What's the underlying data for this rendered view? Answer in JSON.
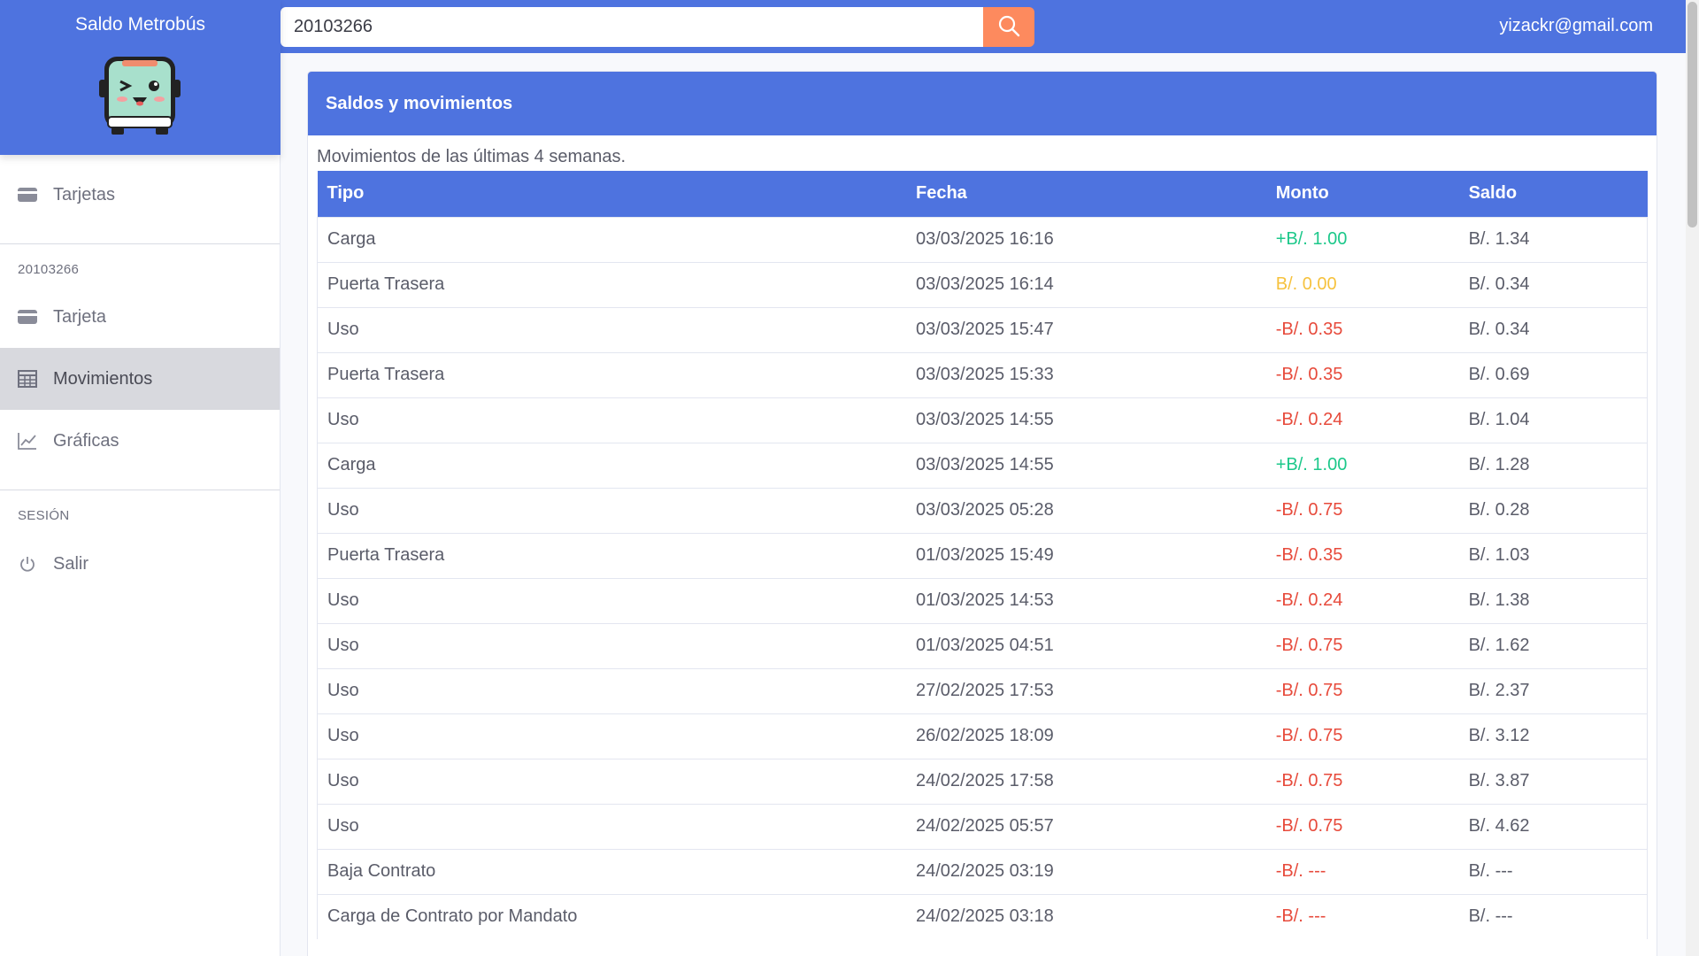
{
  "brand": {
    "title": "Saldo Metrobús",
    "logo_icon": "bus-mascot-icon"
  },
  "search": {
    "value": "20103266",
    "placeholder": "",
    "icon": "search-icon"
  },
  "user": {
    "email": "yizackr@gmail.com"
  },
  "sidebar": {
    "top_item": {
      "label": "Tarjetas",
      "icon": "card-icon"
    },
    "card_heading": "20103266",
    "card_items": [
      {
        "label": "Tarjeta",
        "icon": "card-icon"
      },
      {
        "label": "Movimientos",
        "icon": "table-icon",
        "active": true
      },
      {
        "label": "Gráficas",
        "icon": "line-chart-icon"
      }
    ],
    "session_heading": "SESIÓN",
    "session_items": [
      {
        "label": "Salir",
        "icon": "power-icon"
      }
    ]
  },
  "main": {
    "card_title": "Saldos y movimientos",
    "subtitle": "Movimientos de las últimas 4 semanas.",
    "columns": [
      "Tipo",
      "Fecha",
      "Monto",
      "Saldo"
    ],
    "rows": [
      {
        "tipo": "Carga",
        "fecha": "03/03/2025 16:16",
        "monto": "+B/. 1.00",
        "kind": "pos",
        "saldo": "B/. 1.34"
      },
      {
        "tipo": "Puerta Trasera",
        "fecha": "03/03/2025 16:14",
        "monto": "B/. 0.00",
        "kind": "zero",
        "saldo": "B/. 0.34"
      },
      {
        "tipo": "Uso",
        "fecha": "03/03/2025 15:47",
        "monto": "-B/. 0.35",
        "kind": "neg",
        "saldo": "B/. 0.34"
      },
      {
        "tipo": "Puerta Trasera",
        "fecha": "03/03/2025 15:33",
        "monto": "-B/. 0.35",
        "kind": "neg",
        "saldo": "B/. 0.69"
      },
      {
        "tipo": "Uso",
        "fecha": "03/03/2025 14:55",
        "monto": "-B/. 0.24",
        "kind": "neg",
        "saldo": "B/. 1.04"
      },
      {
        "tipo": "Carga",
        "fecha": "03/03/2025 14:55",
        "monto": "+B/. 1.00",
        "kind": "pos",
        "saldo": "B/. 1.28"
      },
      {
        "tipo": "Uso",
        "fecha": "03/03/2025 05:28",
        "monto": "-B/. 0.75",
        "kind": "neg",
        "saldo": "B/. 0.28"
      },
      {
        "tipo": "Puerta Trasera",
        "fecha": "01/03/2025 15:49",
        "monto": "-B/. 0.35",
        "kind": "neg",
        "saldo": "B/. 1.03"
      },
      {
        "tipo": "Uso",
        "fecha": "01/03/2025 14:53",
        "monto": "-B/. 0.24",
        "kind": "neg",
        "saldo": "B/. 1.38"
      },
      {
        "tipo": "Uso",
        "fecha": "01/03/2025 04:51",
        "monto": "-B/. 0.75",
        "kind": "neg",
        "saldo": "B/. 1.62"
      },
      {
        "tipo": "Uso",
        "fecha": "27/02/2025 17:53",
        "monto": "-B/. 0.75",
        "kind": "neg",
        "saldo": "B/. 2.37"
      },
      {
        "tipo": "Uso",
        "fecha": "26/02/2025 18:09",
        "monto": "-B/. 0.75",
        "kind": "neg",
        "saldo": "B/. 3.12"
      },
      {
        "tipo": "Uso",
        "fecha": "24/02/2025 17:58",
        "monto": "-B/. 0.75",
        "kind": "neg",
        "saldo": "B/. 3.87"
      },
      {
        "tipo": "Uso",
        "fecha": "24/02/2025 05:57",
        "monto": "-B/. 0.75",
        "kind": "neg",
        "saldo": "B/. 4.62"
      },
      {
        "tipo": "Baja Contrato",
        "fecha": "24/02/2025 03:19",
        "monto": "-B/. ---",
        "kind": "neg",
        "saldo": "B/. ---"
      },
      {
        "tipo": "Carga de Contrato por Mandato",
        "fecha": "24/02/2025 03:18",
        "monto": "-B/. ---",
        "kind": "neg",
        "saldo": "B/. ---"
      }
    ]
  },
  "colors": {
    "primary": "#4e73df",
    "search_button": "#fd8a5e",
    "positive": "#1cc88a",
    "negative": "#e74a3b",
    "zero": "#f6c23e"
  }
}
